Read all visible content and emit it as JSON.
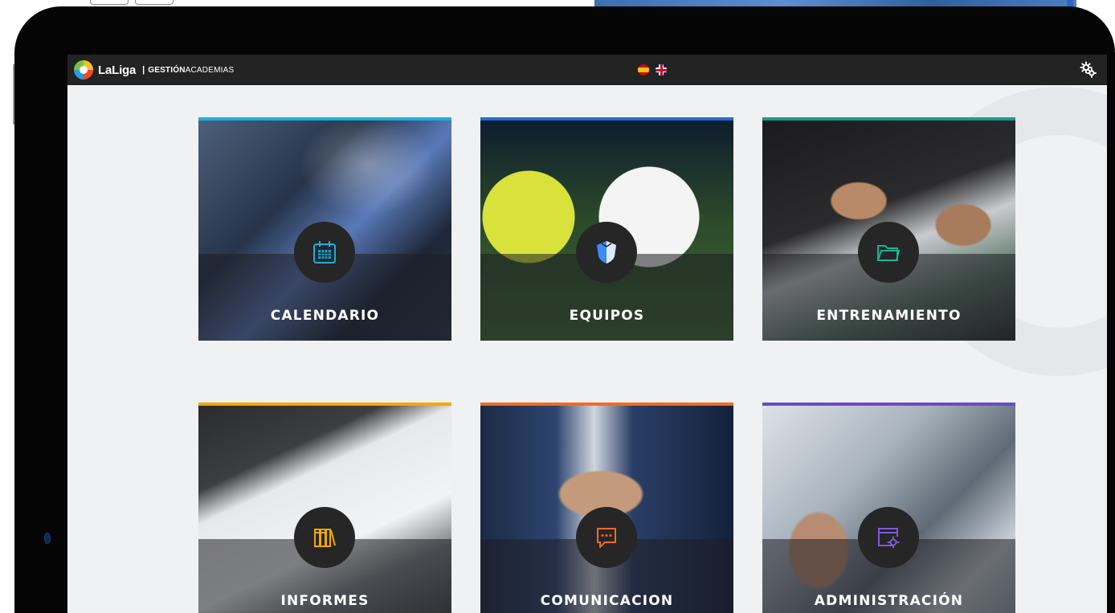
{
  "header": {
    "logo_text": "LaLiga",
    "separator": "|",
    "brand_bold": "GESTIÓN",
    "brand_light": "ACADEMIAS",
    "languages": [
      {
        "code": "es",
        "icon": "spain-flag-icon"
      },
      {
        "code": "en",
        "icon": "uk-flag-icon"
      }
    ],
    "settings_icon": "gears-icon"
  },
  "tiles": [
    {
      "label": "CALENDARIO",
      "icon": "calendar-icon",
      "accent": "#1ab0e0",
      "icon_color": "#1ab0e0"
    },
    {
      "label": "EQUIPOS",
      "icon": "shield-icon",
      "accent": "#1f6fd1",
      "icon_color": "#3a8cf0"
    },
    {
      "label": "ENTRENAMIENTO",
      "icon": "folder-icon",
      "accent": "#13a08a",
      "icon_color": "#19b394"
    },
    {
      "label": "INFORMES",
      "icon": "books-icon",
      "accent": "#f2a900",
      "icon_color": "#f2a900"
    },
    {
      "label": "COMUNICACION",
      "icon": "chat-icon",
      "accent": "#f26b21",
      "icon_color": "#f26b21"
    },
    {
      "label": "ADMINISTRACIÓN",
      "icon": "settings-window-icon",
      "accent": "#6b4bc4",
      "icon_color": "#7b5bd6"
    }
  ]
}
